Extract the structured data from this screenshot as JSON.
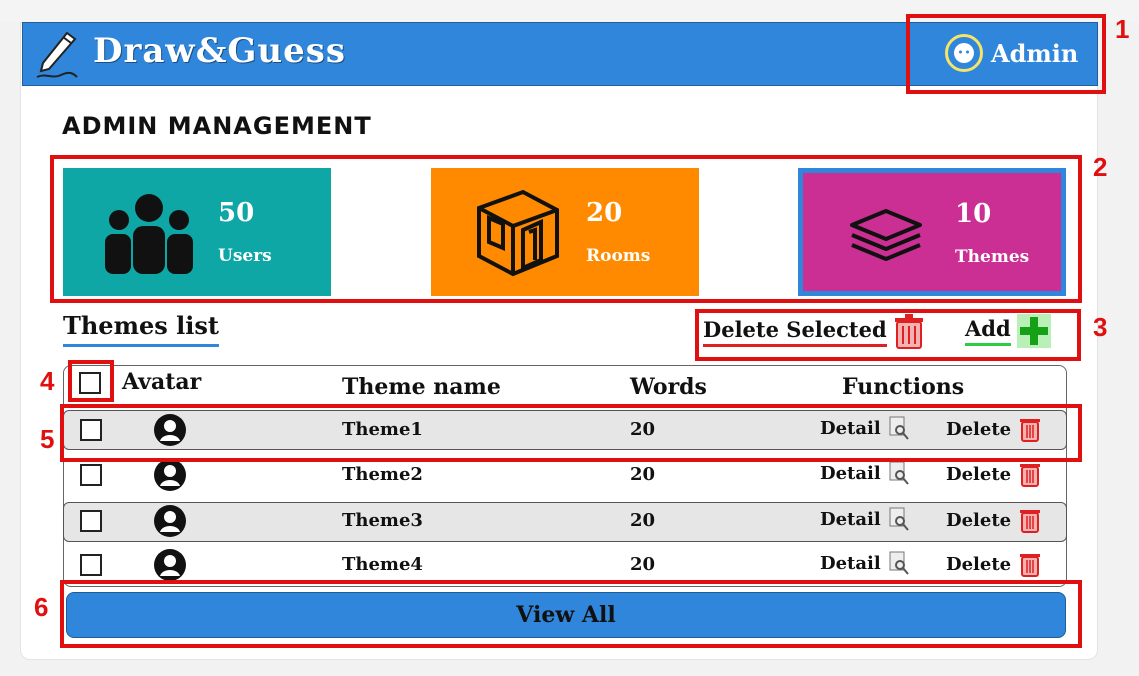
{
  "app": {
    "title": "Draw&Guess",
    "user_label": "Admin"
  },
  "page_title": "ADMIN MANAGEMENT",
  "stats": [
    {
      "value": "50",
      "label": "Users",
      "icon": "users-icon",
      "color": "#0fa6a6"
    },
    {
      "value": "20",
      "label": "Rooms",
      "icon": "room-cube-icon",
      "color": "#ff8a00"
    },
    {
      "value": "10",
      "label": "Themes",
      "icon": "layers-icon",
      "color": "#cc2f93"
    }
  ],
  "themes_list": {
    "title": "Themes list",
    "delete_selected_label": "Delete Selected",
    "add_label": "Add",
    "columns": {
      "avatar": "Avatar",
      "theme_name": "Theme name",
      "words": "Words",
      "functions": "Functions"
    },
    "rows": [
      {
        "name": "Theme1",
        "words": "20",
        "detail": "Detail",
        "delete": "Delete"
      },
      {
        "name": "Theme2",
        "words": "20",
        "detail": "Detail",
        "delete": "Delete"
      },
      {
        "name": "Theme3",
        "words": "20",
        "detail": "Detail",
        "delete": "Delete"
      },
      {
        "name": "Theme4",
        "words": "20",
        "detail": "Detail",
        "delete": "Delete"
      }
    ],
    "view_all_label": "View All"
  },
  "annotations": [
    "1",
    "2",
    "3",
    "4",
    "5",
    "6"
  ],
  "colors": {
    "header_blue": "#2f86db",
    "annotation_red": "#e01010",
    "add_green": "#16a016",
    "delete_red": "#e02020"
  }
}
